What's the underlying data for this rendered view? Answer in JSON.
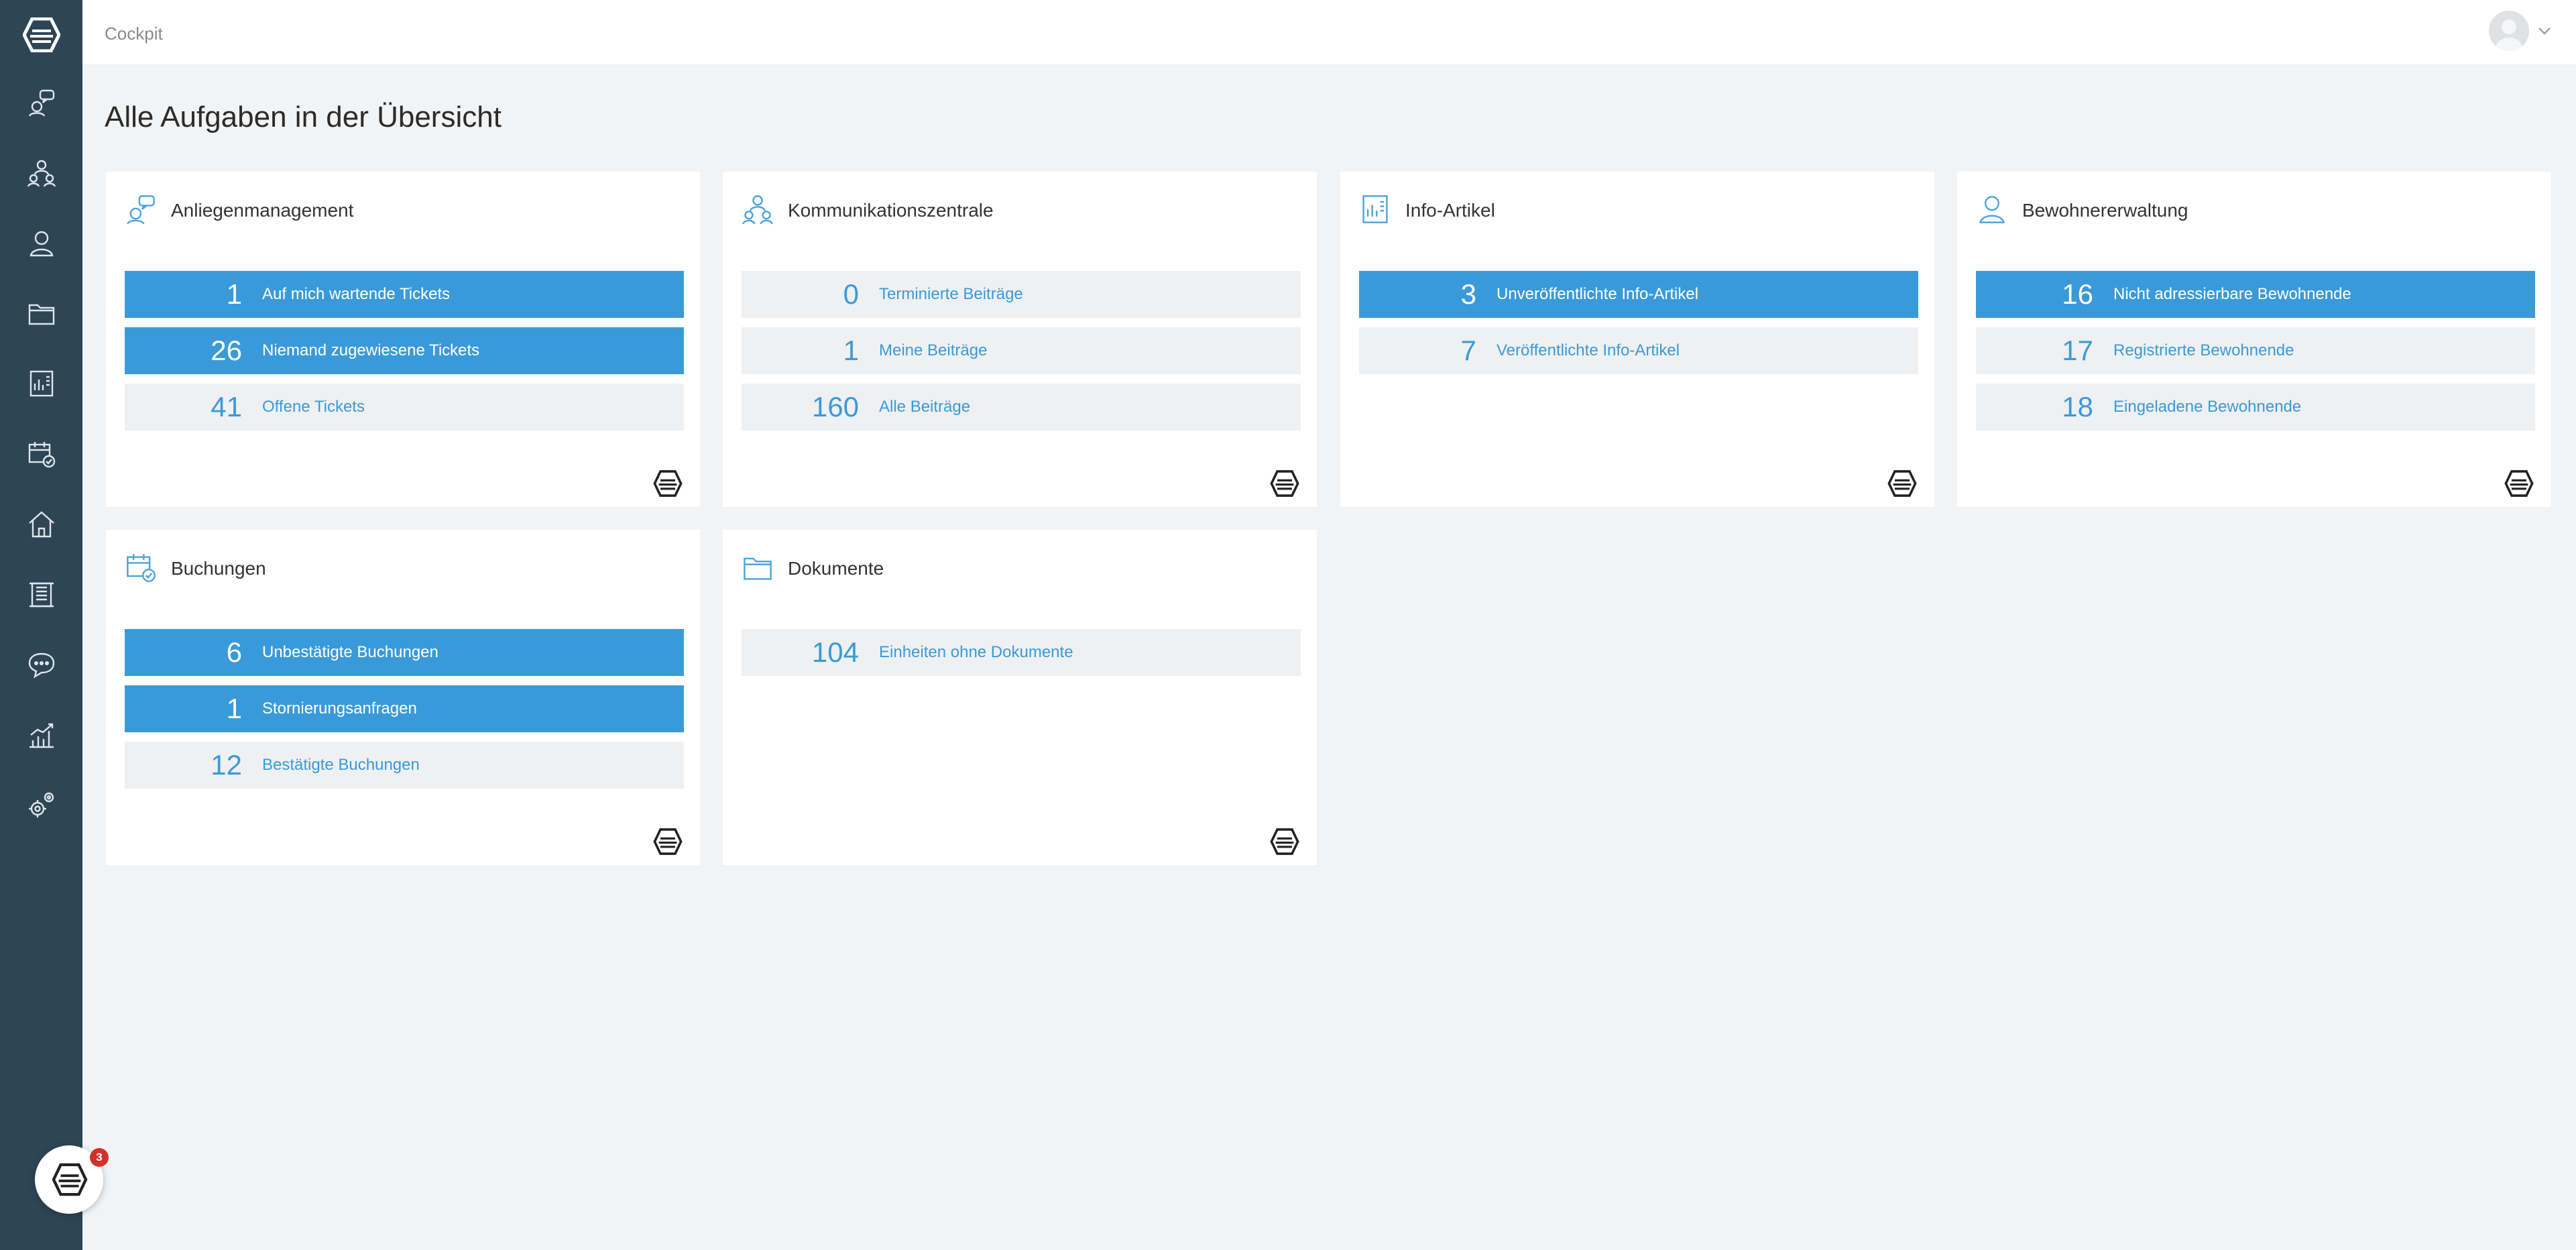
{
  "header": {
    "breadcrumb": "Cockpit"
  },
  "page": {
    "title": "Alle Aufgaben in der Übersicht"
  },
  "sidebar": {
    "items": [
      {
        "icon": "support-chat-icon"
      },
      {
        "icon": "communication-icon"
      },
      {
        "icon": "person-icon"
      },
      {
        "icon": "folder-icon"
      },
      {
        "icon": "report-icon"
      },
      {
        "icon": "calendar-check-icon"
      },
      {
        "icon": "home-icon"
      },
      {
        "icon": "building-icon"
      },
      {
        "icon": "chat-bubble-icon"
      },
      {
        "icon": "analytics-icon"
      },
      {
        "icon": "settings-icon"
      }
    ]
  },
  "cards": [
    {
      "title": "Anliegenmanagement",
      "icon": "support-chat-icon",
      "rows": [
        {
          "count": "1",
          "label": "Auf mich wartende Tickets",
          "active": true
        },
        {
          "count": "26",
          "label": "Niemand zugewiesene Tickets",
          "active": true
        },
        {
          "count": "41",
          "label": "Offene Tickets",
          "active": false
        }
      ]
    },
    {
      "title": "Kommunikationszentrale",
      "icon": "communication-icon",
      "rows": [
        {
          "count": "0",
          "label": "Terminierte Beiträge",
          "active": false
        },
        {
          "count": "1",
          "label": "Meine Beiträge",
          "active": false
        },
        {
          "count": "160",
          "label": "Alle Beiträge",
          "active": false
        }
      ]
    },
    {
      "title": "Info-Artikel",
      "icon": "report-icon",
      "rows": [
        {
          "count": "3",
          "label": "Unveröffentlichte Info-Artikel",
          "active": true
        },
        {
          "count": "7",
          "label": "Veröffentlichte Info-Artikel",
          "active": false
        }
      ]
    },
    {
      "title": "Bewohnererwaltung",
      "icon": "person-icon",
      "rows": [
        {
          "count": "16",
          "label": "Nicht adressierbare Bewohnende",
          "active": true
        },
        {
          "count": "17",
          "label": "Registrierte Bewohnende",
          "active": false
        },
        {
          "count": "18",
          "label": "Eingeladene Bewohnende",
          "active": false
        }
      ]
    },
    {
      "title": "Buchungen",
      "icon": "calendar-check-icon",
      "rows": [
        {
          "count": "6",
          "label": "Unbestätigte Buchungen",
          "active": true
        },
        {
          "count": "1",
          "label": "Stornierungsanfragen",
          "active": true
        },
        {
          "count": "12",
          "label": "Bestätigte Buchungen",
          "active": false
        }
      ]
    },
    {
      "title": "Dokumente",
      "icon": "folder-icon",
      "rows": [
        {
          "count": "104",
          "label": "Einheiten ohne Dokumente",
          "active": false
        }
      ]
    }
  ],
  "chat": {
    "badge": "3",
    "icon": "brand-chat-icon"
  },
  "colors": {
    "sidebar": "#2e4556",
    "accent": "#3a9ad9",
    "inactive_row": "#eef0f2",
    "badge": "#d0312d"
  }
}
